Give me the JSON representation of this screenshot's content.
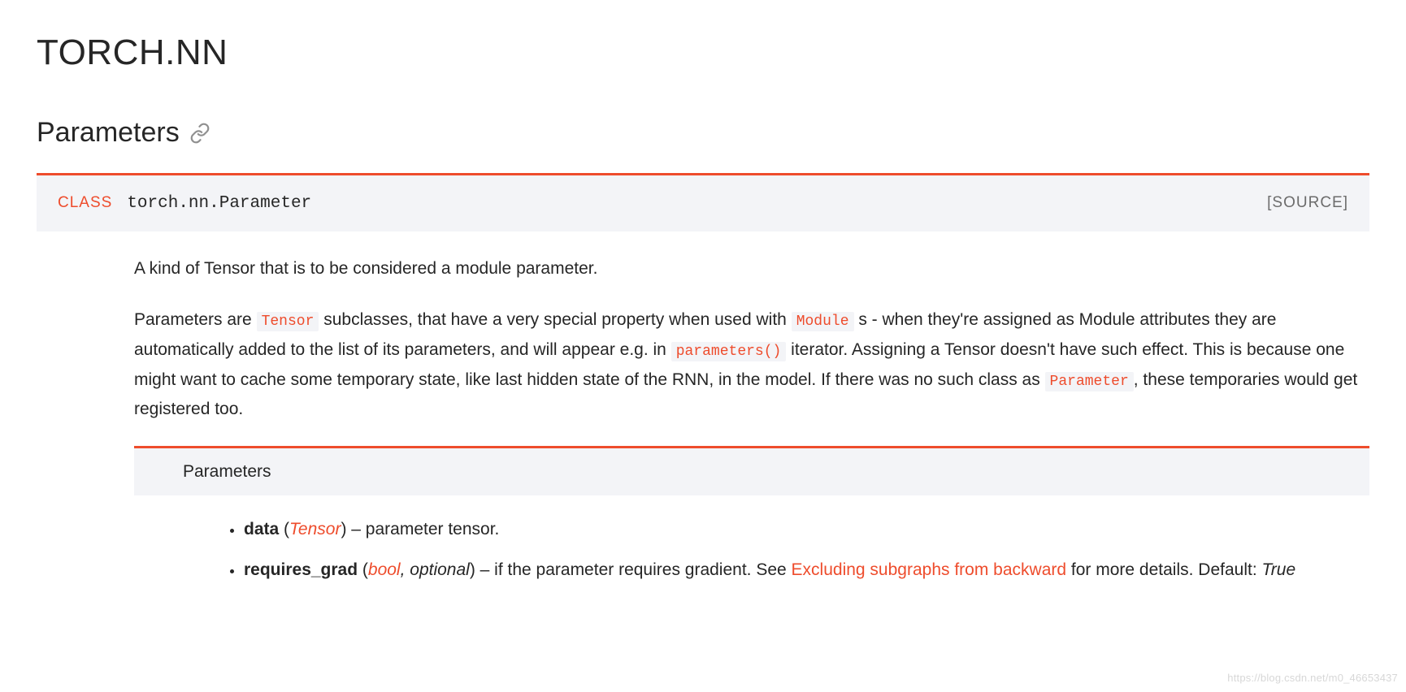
{
  "page": {
    "title": "TORCH.NN",
    "section": "Parameters"
  },
  "class_def": {
    "keyword": "CLASS",
    "fqname": "torch.nn.Parameter",
    "source_label": "[SOURCE]"
  },
  "description": {
    "intro": "A kind of Tensor that is to be considered a module parameter.",
    "detail1_a": "Parameters are ",
    "detail1_tensor": "Tensor",
    "detail1_b": " subclasses, that have a very special property when used with ",
    "detail1_module": "Module",
    "detail1_c": " s - when they're assigned as Module attributes they are automatically added to the list of its parameters, and will appear e.g. in ",
    "detail1_paramfn": "parameters()",
    "detail1_d": " iterator. Assigning a Tensor doesn't have such effect. This is because one might want to cache some temporary state, like last hidden state of the RNN, in the model. If there was no such class as ",
    "detail1_paramcls": "Parameter",
    "detail1_e": ", these temporaries would get registered too."
  },
  "params_section": {
    "heading": "Parameters",
    "items": [
      {
        "name": "data",
        "open": " (",
        "type_link": "Tensor",
        "type_plain": "",
        "close": ") – ",
        "desc_a": "parameter tensor.",
        "link_text": "",
        "desc_b": ""
      },
      {
        "name": "requires_grad",
        "open": " (",
        "type_link": "bool",
        "type_plain": ", optional",
        "close": ") – ",
        "desc_a": "if the parameter requires gradient. See ",
        "link_text": "Excluding subgraphs from backward",
        "desc_b": " for more details. Default: ",
        "default_italic": "True"
      }
    ]
  },
  "watermark": "https://blog.csdn.net/m0_46653437"
}
